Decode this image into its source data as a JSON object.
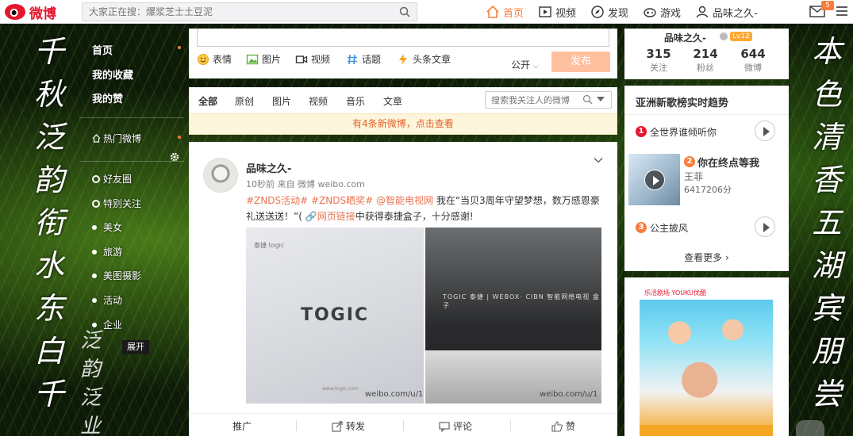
{
  "topbar": {
    "logo_text": "微博",
    "search_placeholder": "大家正在搜：爆浆芝士土豆泥",
    "nav": [
      {
        "label": "首页",
        "icon": "home-icon",
        "active": true
      },
      {
        "label": "视频",
        "icon": "video-icon",
        "active": false
      },
      {
        "label": "发现",
        "icon": "compass-icon",
        "active": false
      },
      {
        "label": "游戏",
        "icon": "gamepad-icon",
        "active": false
      },
      {
        "label": "品味之久-",
        "icon": "user-icon",
        "active": false
      }
    ],
    "mail_badge": "5",
    "accent_color": "#fa7d3c"
  },
  "calligraphy": {
    "left": "千秋泛韵衔水东白千",
    "right": "本色清香五湖宾朋尝",
    "small": "泛韵泛业"
  },
  "leftnav": {
    "main": [
      "首页",
      "我的收藏",
      "我的赞"
    ],
    "hot": "热门微博",
    "groups": [
      "好友圈",
      "特别关注"
    ],
    "items": [
      "美女",
      "旅游",
      "美图摄影",
      "活动",
      "企业"
    ],
    "expand": "展开"
  },
  "composer": {
    "tools": [
      "表情",
      "图片",
      "视频",
      "话题",
      "头条文章"
    ],
    "visibility": "公开",
    "publish": "发布"
  },
  "tabs": {
    "items": [
      "全部",
      "原创",
      "图片",
      "视频",
      "音乐",
      "文章"
    ],
    "search_placeholder": "搜索我关注人的微博"
  },
  "new_notice": "有4条新微博，点击查看",
  "post": {
    "author": "品味之久-",
    "meta": "10秒前 来自 微博 weibo.com",
    "text_tag1": "#ZNDS活动#",
    "text_tag2": "#ZNDS晒奖#",
    "text_mention": "@智能电视网",
    "text_body1": " 我在“当贝3周年守望梦想，数万感恩豪礼送送送！”(",
    "text_link": "网页链接",
    "text_body2": "中获得泰捷盒子，十分感谢!",
    "image_left_brand": "TOGIC",
    "image_left_small": "泰捷 togic",
    "image_left_footer": "www.togic.com",
    "image_right_strip": "TOGIC 泰捷 | WEBOX· CIBN 智能网络电视 盒子",
    "watermark": "weibo.com/u/1",
    "actions": [
      "推广",
      "转发",
      "评论",
      "赞"
    ]
  },
  "profile": {
    "name": "品味之久-",
    "level": "Lv12",
    "stats": [
      {
        "num": "315",
        "label": "关注"
      },
      {
        "num": "214",
        "label": "粉丝"
      },
      {
        "num": "644",
        "label": "微博"
      }
    ]
  },
  "trend": {
    "title": "亚洲新歌榜实时趋势",
    "songs": [
      {
        "rank": "1",
        "title": "全世界谁倾听你"
      },
      {
        "rank": "2",
        "title": "你在终点等我",
        "artist": "王菲",
        "score": "6417206分"
      },
      {
        "rank": "3",
        "title": "公主披风"
      }
    ],
    "more": "查看更多"
  },
  "ad": {
    "top_text": "乐活剧场 YOUKU优酷"
  }
}
